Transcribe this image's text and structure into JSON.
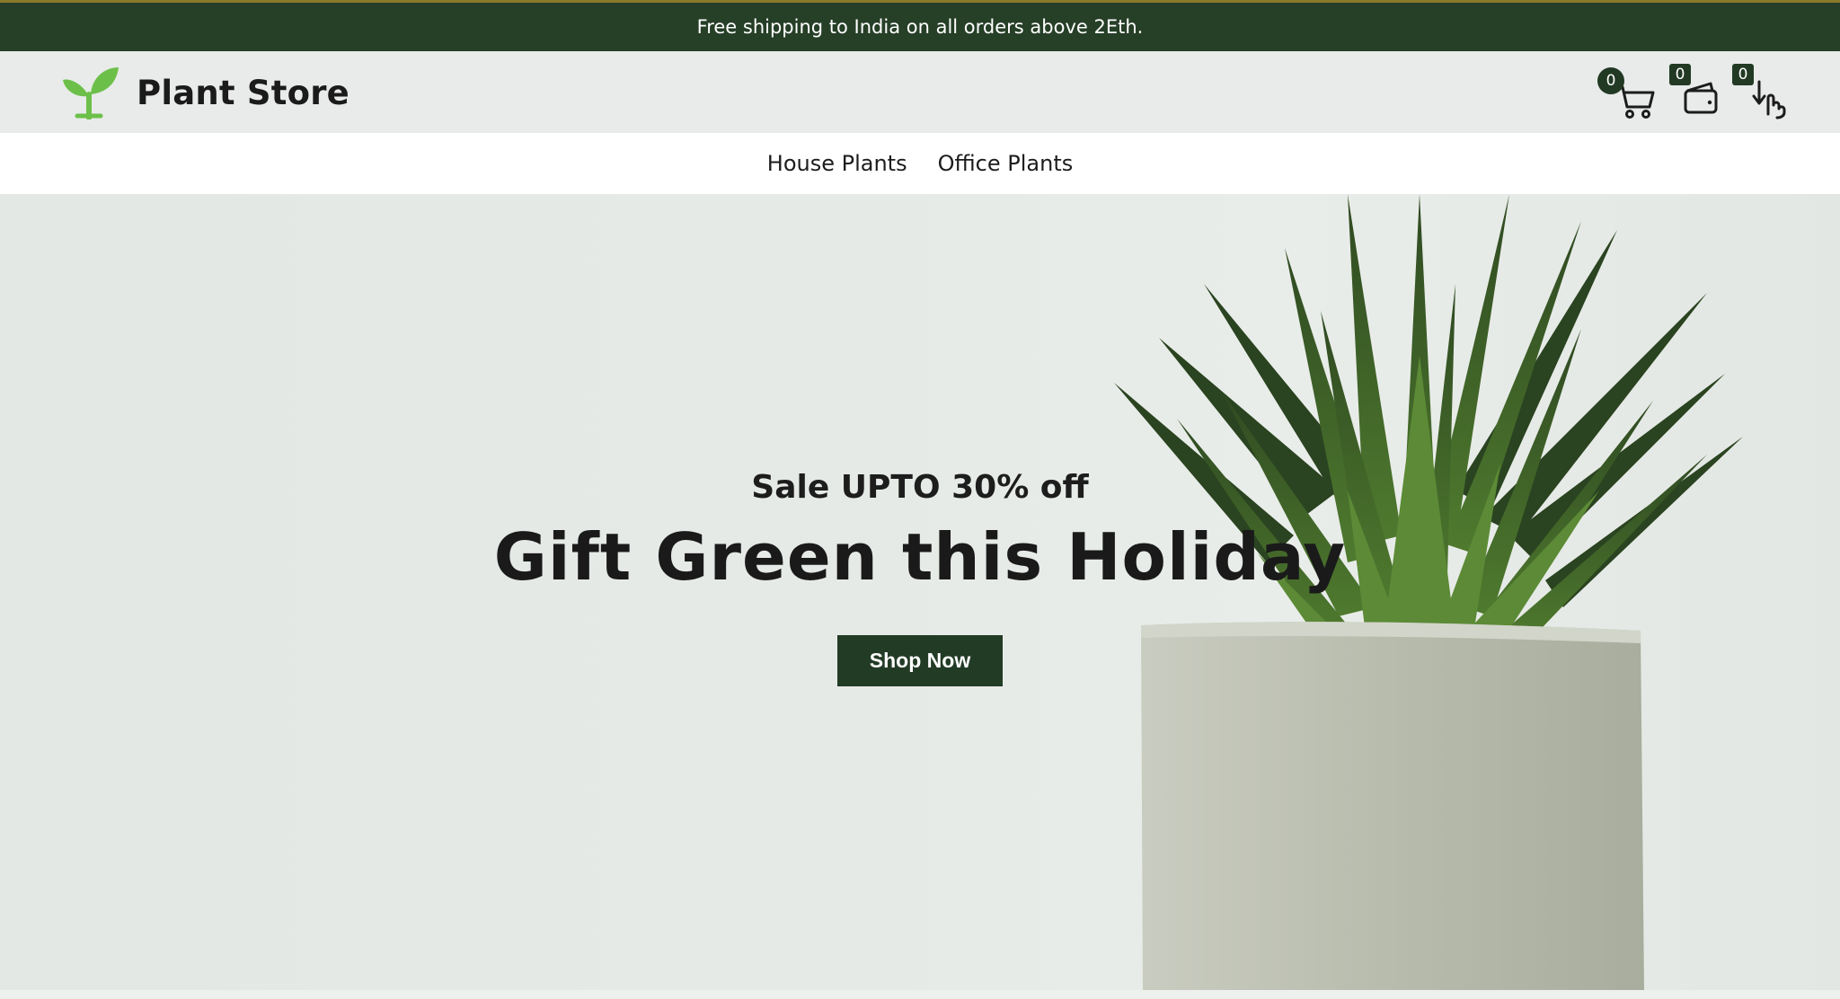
{
  "announcement": {
    "text": "Free shipping to India on all orders above 2Eth."
  },
  "header": {
    "logo_text": "Plant Store",
    "logo_icon": "sprout-icon",
    "icons": [
      {
        "name": "cart-icon",
        "count": "0"
      },
      {
        "name": "wallet-icon",
        "count": "0"
      },
      {
        "name": "touch-icon",
        "count": "0"
      }
    ]
  },
  "nav": {
    "items": [
      {
        "label": "House Plants"
      },
      {
        "label": "Office Plants"
      }
    ]
  },
  "hero": {
    "subtitle": "Sale UPTO 30% off",
    "title": "Gift Green this Holiday",
    "cta_label": "Shop Now",
    "image": "potted-succulent-plant"
  },
  "colors": {
    "brand_dark": "#263f27",
    "logo_green": "#6cc04a",
    "hero_bg": "#e6eae6"
  }
}
